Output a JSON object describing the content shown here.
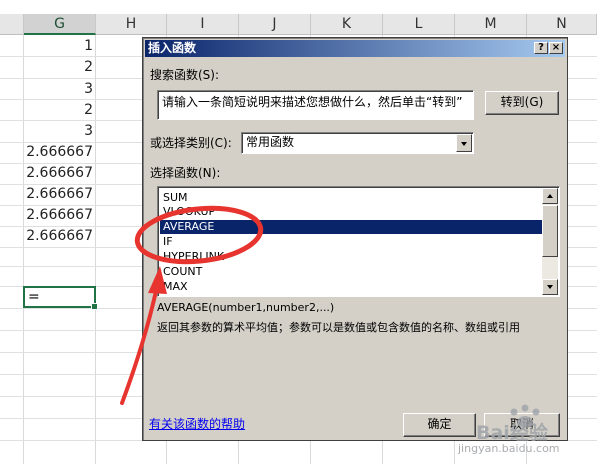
{
  "sheet": {
    "columns": [
      "G",
      "H",
      "I",
      "J",
      "K",
      "L",
      "M",
      "N"
    ],
    "selected_column": "G",
    "g_values": [
      "1",
      "2",
      "3",
      "2",
      "3",
      "2.666667",
      "2.666667",
      "2.666667",
      "2.666667",
      "2.666667"
    ],
    "active_cell_text": "="
  },
  "dialog": {
    "title": "插入函数",
    "help_button": "?",
    "close_button": "×",
    "search_label": "搜索函数(S):",
    "search_text": "请输入一条简短说明来描述您想做什么，然后单击“转到”",
    "go_button": "转到(G)",
    "category_label": "或选择类别(C):",
    "category_value": "常用函数",
    "select_label": "选择函数(N):",
    "functions": [
      "SUM",
      "VLOOKUP",
      "AVERAGE",
      "IF",
      "HYPERLINK",
      "COUNT",
      "MAX"
    ],
    "selected_function": "AVERAGE",
    "signature": "AVERAGE(number1,number2,...)",
    "description": "返回其参数的算术平均值；参数可以是数值或包含数值的名称、数组或引用",
    "help_link": "有关该函数的帮助",
    "ok_button": "确定",
    "cancel_button": "取消"
  },
  "colors": {
    "title_bar": "#0a246a",
    "selection": "#0a246a",
    "annotation": "#e8342f",
    "excel_green": "#217346"
  },
  "watermark": {
    "brand": "Bai经验",
    "url": "jingyan.baidu.com"
  }
}
